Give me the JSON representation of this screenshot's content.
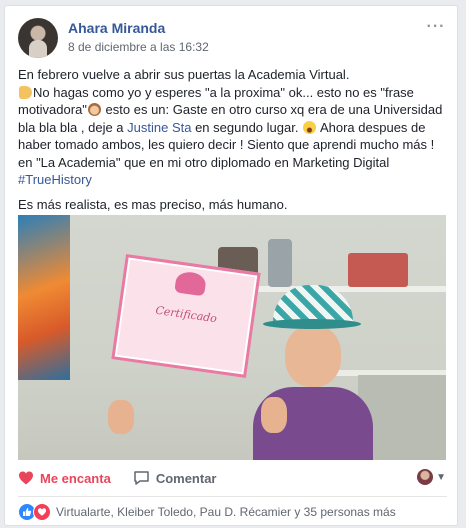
{
  "post": {
    "author": "Ahara Miranda",
    "timestamp": "8 de diciembre a las 16:32",
    "more_label": "···",
    "paragraph1_line1": "En febrero vuelve a abrir sus puertas la Academia Virtual.",
    "paragraph1_line2_start": "No hagas como yo y esperes \"a la proxima\" ok... esto no es \"frase motivadora\"",
    "paragraph1_line2_mid": " esto es un: Gaste en otro curso xq era de una Universidad bla bla bla , deje a ",
    "mention": "Justine Sta",
    "paragraph1_line2_end": " en segundo lugar.",
    "paragraph1_line3": " Ahora despues de haber tomado ambos, les quiero decir ! Siento que aprendi mucho más ! en \"La Academia\" que en mi otro diplomado en Marketing Digital ",
    "hashtag": "#TrueHistory",
    "paragraph2": "Es más realista, es mas preciso, más humano."
  },
  "photo": {
    "certificate_title": "Certificado"
  },
  "actions": {
    "love_label": "Me encanta",
    "comment_label": "Comentar"
  },
  "summary": {
    "names": "Virtualarte, Kleiber Toledo, Pau D. Récamier y 35 personas más"
  },
  "colors": {
    "link": "#365899",
    "love": "#e9455b",
    "like": "#2d88ff"
  }
}
